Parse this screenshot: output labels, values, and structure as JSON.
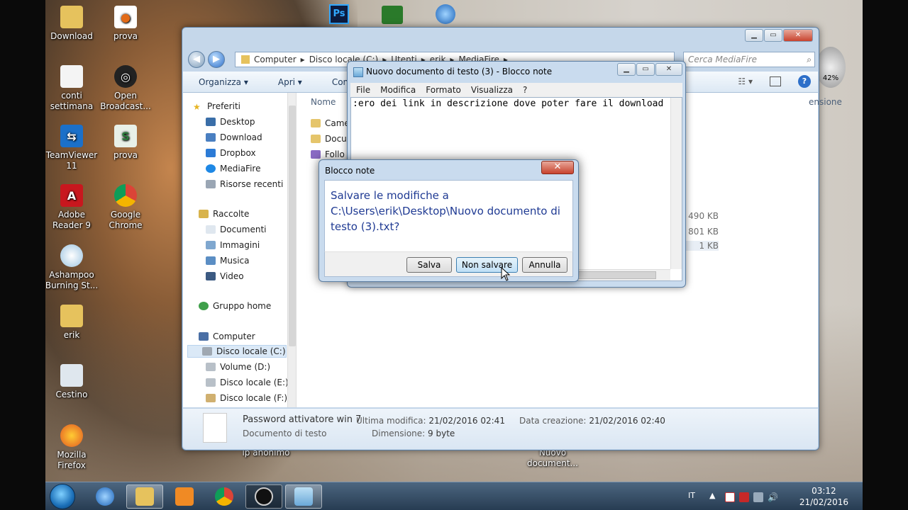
{
  "desktop": {
    "icons": [
      {
        "label": "Download",
        "name": "desktop-icon-download"
      },
      {
        "label": "prova",
        "name": "desktop-icon-prova-firefox"
      },
      {
        "label": "conti settimana",
        "name": "desktop-icon-conti-settimana"
      },
      {
        "label": "Open Broadcast...",
        "name": "desktop-icon-obs"
      },
      {
        "label": "TeamViewer 11",
        "name": "desktop-icon-teamviewer"
      },
      {
        "label": "prova",
        "name": "desktop-icon-prova-script"
      },
      {
        "label": "Adobe Reader 9",
        "name": "desktop-icon-adobe-reader"
      },
      {
        "label": "Google Chrome",
        "name": "desktop-icon-chrome"
      },
      {
        "label": "Ashampoo Burning St...",
        "name": "desktop-icon-ashampoo"
      },
      {
        "label": "erik",
        "name": "desktop-icon-erik"
      },
      {
        "label": "Cestino",
        "name": "desktop-icon-cestino"
      },
      {
        "label": "Mozilla Firefox",
        "name": "desktop-icon-firefox"
      },
      {
        "label": "Nuovo document...",
        "name": "desktop-icon-nuovo-documento"
      },
      {
        "label": "ip anonimo",
        "name": "desktop-icon-ip-anonimo"
      }
    ],
    "top_icons": [
      "Ps",
      "CORE",
      "Net"
    ]
  },
  "explorer": {
    "breadcrumb": [
      "Computer",
      "Disco locale (C:)",
      "Utenti",
      "erik",
      "MediaFire"
    ],
    "search_placeholder": "Cerca MediaFire",
    "toolbar": {
      "organize": "Organizza",
      "open": "Apri",
      "share": "Cond"
    },
    "nav": {
      "favorites": "Preferiti",
      "desktop": "Desktop",
      "download": "Download",
      "dropbox": "Dropbox",
      "mediafire": "MediaFire",
      "recent": "Risorse recenti",
      "libraries": "Raccolte",
      "documents": "Documenti",
      "images": "Immagini",
      "music": "Musica",
      "video": "Video",
      "homegroup": "Gruppo home",
      "computer": "Computer",
      "disk_c": "Disco locale (C:)",
      "disk_d": "Volume (D:)",
      "disk_e": "Disco locale (E:)",
      "disk_f": "Disco locale (F:)"
    },
    "columns": {
      "name": "Nome",
      "size": "ensione"
    },
    "files": [
      {
        "name": "Came"
      },
      {
        "name": "Docu"
      },
      {
        "name": "Follo"
      }
    ],
    "sizes": [
      "490 KB",
      "801 KB",
      "1 KB"
    ],
    "details": {
      "filename": "Password attivatore win 7",
      "type": "Documento di testo",
      "modified_label": "Ultima modifica:",
      "modified_value": "21/02/2016 02:41",
      "size_label": "Dimensione:",
      "size_value": "9 byte",
      "created_label": "Data creazione:",
      "created_value": "21/02/2016 02:40"
    }
  },
  "notepad": {
    "title": "Nuovo documento di testo (3) - Blocco note",
    "menu": [
      "File",
      "Modifica",
      "Formato",
      "Visualizza",
      "?"
    ],
    "content": ":ero dei link in descrizione dove poter fare il download"
  },
  "dialog": {
    "title": "Blocco note",
    "message": "Salvare le modifiche a C:\\Users\\erik\\Desktop\\Nuovo documento di testo (3).txt?",
    "save": "Salva",
    "dont_save": "Non salvare",
    "cancel": "Annulla"
  },
  "taskbar": {
    "lang": "IT",
    "time": "03:12",
    "date": "21/02/2016"
  },
  "gadget": {
    "value": "42%"
  }
}
